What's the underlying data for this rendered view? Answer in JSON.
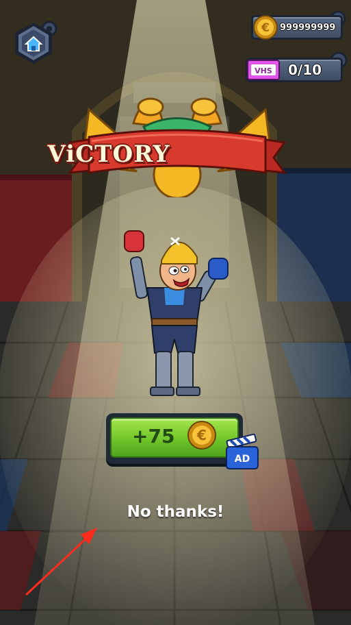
{
  "hud": {
    "coins_value": "999999999",
    "vhs_value": "0/10",
    "vhs_label": "VHS"
  },
  "banner": {
    "title": "ViCTORY"
  },
  "reward": {
    "amount_label": "+75",
    "ad_badge_label": "AD"
  },
  "dismiss": {
    "label": "No thanks!"
  },
  "colors": {
    "banner_red": "#d83a2e",
    "reward_green": "#7fd12f",
    "floor_red": "#6a1d1f",
    "floor_blue": "#1d2f4f",
    "spotlight": "#fff5c4",
    "annotation_arrow": "#ff2b1c"
  },
  "icons": {
    "home": "home-icon",
    "coin": "coin-icon",
    "vhs": "vhs-tape-icon",
    "ad": "clapperboard-ad-icon",
    "arrow": "annotation-arrow-icon"
  }
}
